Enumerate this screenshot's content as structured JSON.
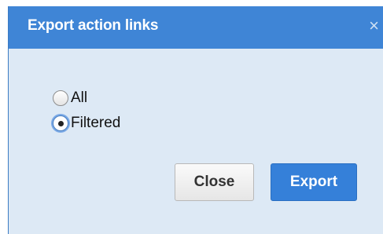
{
  "dialog": {
    "title": "Export action links",
    "close_icon": "×",
    "options": [
      {
        "label": "All",
        "checked": false
      },
      {
        "label": "Filtered",
        "checked": true
      }
    ],
    "buttons": {
      "close_label": "Close",
      "export_label": "Export"
    }
  },
  "colors": {
    "titlebar": "#3f85d6",
    "body_background": "#dde9f5",
    "primary_button": "#3580d9"
  }
}
